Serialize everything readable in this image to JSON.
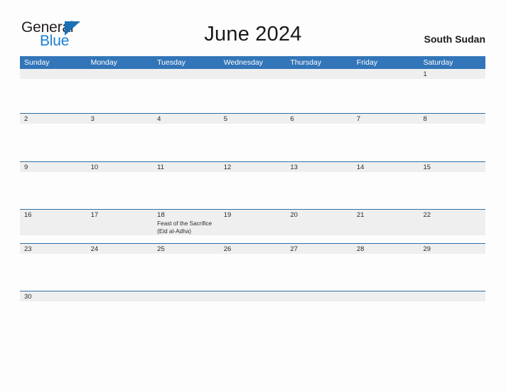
{
  "logo": {
    "word_one": "General",
    "word_two": "Blue",
    "triangle_color": "#1a6fb5",
    "blue_color": "#1a7fd4"
  },
  "header": {
    "title": "June 2024",
    "region": "South Sudan"
  },
  "theme": {
    "header_blue": "#3275b8",
    "separator_blue": "#2f6fa8",
    "date_strip_gray": "#efefef",
    "page_background": "#fdfdfd"
  },
  "calendar": {
    "weekdays": [
      "Sunday",
      "Monday",
      "Tuesday",
      "Wednesday",
      "Thursday",
      "Friday",
      "Saturday"
    ],
    "weeks": [
      {
        "body_height": 48,
        "days": [
          {
            "num": "",
            "event": ""
          },
          {
            "num": "",
            "event": ""
          },
          {
            "num": "",
            "event": ""
          },
          {
            "num": "",
            "event": ""
          },
          {
            "num": "",
            "event": ""
          },
          {
            "num": "",
            "event": ""
          },
          {
            "num": "1",
            "event": ""
          }
        ]
      },
      {
        "body_height": 53,
        "days": [
          {
            "num": "2",
            "event": ""
          },
          {
            "num": "3",
            "event": ""
          },
          {
            "num": "4",
            "event": ""
          },
          {
            "num": "5",
            "event": ""
          },
          {
            "num": "6",
            "event": ""
          },
          {
            "num": "7",
            "event": ""
          },
          {
            "num": "8",
            "event": ""
          }
        ]
      },
      {
        "body_height": 52,
        "days": [
          {
            "num": "9",
            "event": ""
          },
          {
            "num": "10",
            "event": ""
          },
          {
            "num": "11",
            "event": ""
          },
          {
            "num": "12",
            "event": ""
          },
          {
            "num": "13",
            "event": ""
          },
          {
            "num": "14",
            "event": ""
          },
          {
            "num": "15",
            "event": ""
          }
        ]
      },
      {
        "body_height": 11,
        "days": [
          {
            "num": "16",
            "event": ""
          },
          {
            "num": "17",
            "event": ""
          },
          {
            "num": "18",
            "event": "Feast of the Sacrifice (Eid al-Adha)"
          },
          {
            "num": "19",
            "event": ""
          },
          {
            "num": "20",
            "event": ""
          },
          {
            "num": "21",
            "event": ""
          },
          {
            "num": "22",
            "event": ""
          }
        ]
      },
      {
        "body_height": 52,
        "days": [
          {
            "num": "23",
            "event": ""
          },
          {
            "num": "24",
            "event": ""
          },
          {
            "num": "25",
            "event": ""
          },
          {
            "num": "26",
            "event": ""
          },
          {
            "num": "27",
            "event": ""
          },
          {
            "num": "28",
            "event": ""
          },
          {
            "num": "29",
            "event": ""
          }
        ]
      },
      {
        "body_height": 6,
        "days": [
          {
            "num": "30",
            "event": ""
          },
          {
            "num": "",
            "event": ""
          },
          {
            "num": "",
            "event": ""
          },
          {
            "num": "",
            "event": ""
          },
          {
            "num": "",
            "event": ""
          },
          {
            "num": "",
            "event": ""
          },
          {
            "num": "",
            "event": ""
          }
        ]
      }
    ]
  }
}
